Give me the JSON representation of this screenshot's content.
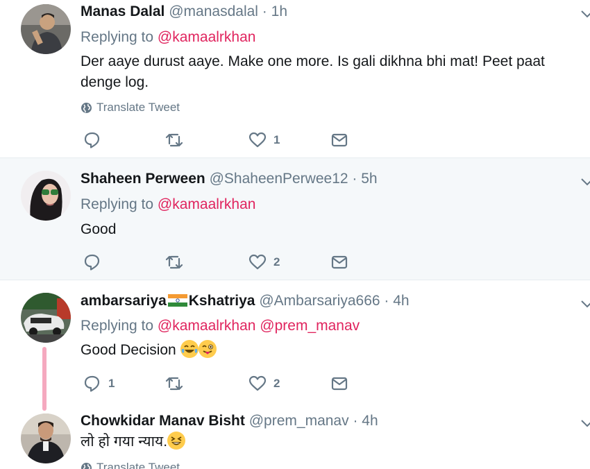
{
  "tweets": [
    {
      "name": "Manas Dalal",
      "handle": "@manasdalal",
      "sep": "·",
      "time": "1h",
      "replying_label": "Replying to",
      "mentions": [
        "@kamaalrkhan"
      ],
      "text": "Der aaye durust aaye. Make one more. Is gali dikhna bhi mat! Peet paat denge log.",
      "translate": "Translate Tweet",
      "reply_count": "",
      "like_count": "1"
    },
    {
      "name": "Shaheen Perween",
      "handle": "@ShaheenPerwee12",
      "sep": "·",
      "time": "5h",
      "replying_label": "Replying to",
      "mentions": [
        "@kamaalrkhan"
      ],
      "text": "Good",
      "reply_count": "",
      "like_count": "2"
    },
    {
      "name_part1": "ambarsariya",
      "name_part2": "Kshatriya",
      "handle": "@Ambarsariya666",
      "sep": "·",
      "time": "4h",
      "replying_label": "Replying to",
      "mentions": [
        "@kamaalrkhan",
        "@prem_manav"
      ],
      "text": "Good Decision",
      "reply_count": "1",
      "like_count": "2"
    },
    {
      "name": "Chowkidar Manav Bisht",
      "handle": "@prem_manav",
      "sep": "·",
      "time": "4h",
      "text": "लो हो गया न्याय.",
      "translate": "Translate Tweet"
    }
  ],
  "colors": {
    "mention": "#e0245e",
    "muted": "#657786",
    "highlight_bg": "#f5f8fa",
    "thread_line": "#f5a9bf"
  },
  "icons": [
    "reply-icon",
    "retweet-icon",
    "like-icon",
    "dm-icon",
    "globe-icon",
    "chevron-down-icon"
  ]
}
